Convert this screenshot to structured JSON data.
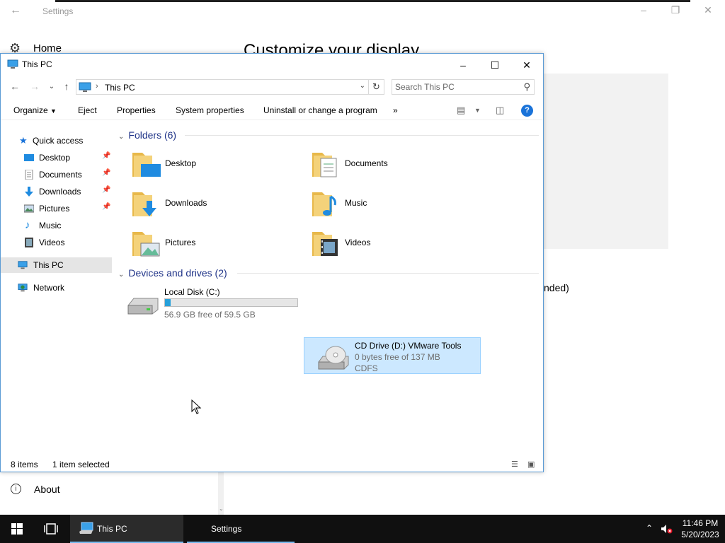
{
  "settings": {
    "title": "Settings",
    "home_label": "Home",
    "heading": "Customize your display",
    "partial_text": "nded)",
    "about_label": "About"
  },
  "explorer": {
    "title": "This PC",
    "address": {
      "crumb": "This PC"
    },
    "search": {
      "placeholder": "Search This PC"
    },
    "toolbar": {
      "organize": "Organize",
      "eject": "Eject",
      "properties": "Properties",
      "system_properties": "System properties",
      "uninstall": "Uninstall or change a program",
      "more": "»"
    },
    "nav": {
      "quick_access": "Quick access",
      "items": [
        {
          "label": "Desktop",
          "pinned": true
        },
        {
          "label": "Documents",
          "pinned": true
        },
        {
          "label": "Downloads",
          "pinned": true
        },
        {
          "label": "Pictures",
          "pinned": true
        },
        {
          "label": "Music",
          "pinned": false
        },
        {
          "label": "Videos",
          "pinned": false
        }
      ],
      "this_pc": "This PC",
      "network": "Network"
    },
    "folders": {
      "heading": "Folders (6)",
      "items": [
        "Desktop",
        "Documents",
        "Downloads",
        "Music",
        "Pictures",
        "Videos"
      ]
    },
    "devices": {
      "heading": "Devices and drives (2)",
      "items": [
        {
          "name": "Local Disk (C:)",
          "free_text": "56.9 GB free of 59.5 GB",
          "used_fraction": 0.044
        },
        {
          "name": "CD Drive (D:) VMware Tools",
          "free_text": "0 bytes free of 137 MB",
          "fs": "CDFS",
          "selected": true
        }
      ]
    },
    "status": {
      "items": "8 items",
      "selected": "1 item selected"
    }
  },
  "taskbar": {
    "tasks": [
      {
        "label": "This PC",
        "active": true
      },
      {
        "label": "Settings",
        "active": false
      }
    ],
    "time": "11:46 PM",
    "date": "5/20/2023"
  },
  "colors": {
    "accent": "#1a73d9",
    "selection": "#cce8ff",
    "drive_bar": "#26a0da",
    "taskbar": "#101010"
  }
}
